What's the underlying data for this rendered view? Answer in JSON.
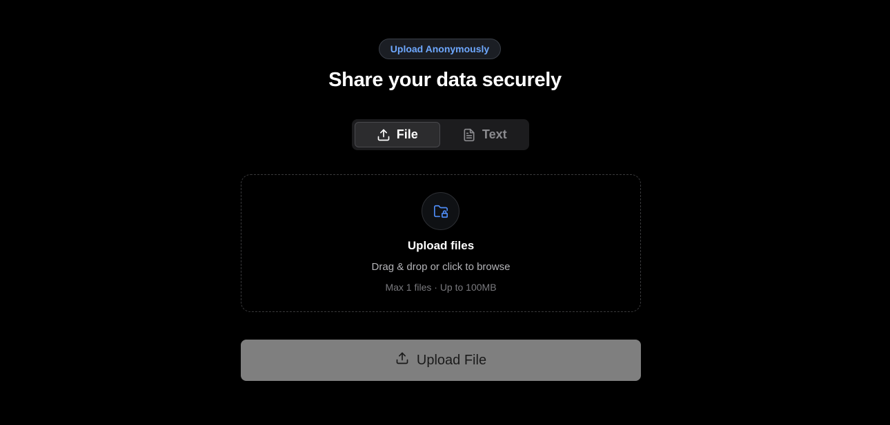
{
  "header": {
    "badge_label": "Upload Anonymously",
    "title": "Share your data securely"
  },
  "tabs": [
    {
      "label": "File",
      "icon": "upload-icon",
      "active": true
    },
    {
      "label": "Text",
      "icon": "document-icon",
      "active": false
    }
  ],
  "dropzone": {
    "icon": "folder-lock-icon",
    "title": "Upload files",
    "subtitle": "Drag & drop or click to browse",
    "limits": "Max 1 files · Up to 100MB"
  },
  "submit": {
    "icon": "upload-icon",
    "label": "Upload File"
  },
  "colors": {
    "accent": "#6ea8ff",
    "background": "#000000",
    "button_disabled": "#7f7f7f"
  }
}
